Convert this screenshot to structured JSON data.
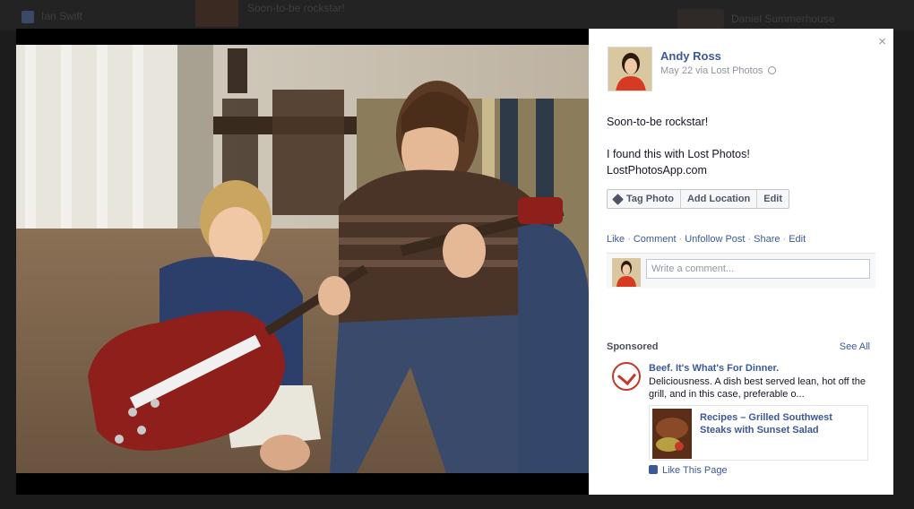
{
  "background": {
    "nav_label": "Ian Swift",
    "feed_text": "Soon-to-be rockstar!",
    "right_name": "Daniel Summerhouse"
  },
  "panel": {
    "close_glyph": "×",
    "author": "Andy Ross",
    "meta": "May 22 via Lost Photos",
    "post_line1": "Soon-to-be rockstar!",
    "post_line2": "I found this with Lost Photos!",
    "post_line3": "LostPhotosApp.com",
    "buttons": {
      "tag_photo": "Tag Photo",
      "add_location": "Add Location",
      "edit": "Edit"
    },
    "actions": {
      "like": "Like",
      "comment": "Comment",
      "unfollow": "Unfollow Post",
      "share": "Share",
      "edit": "Edit",
      "separator": "·"
    },
    "comment_placeholder": "Write a comment..."
  },
  "sponsored": {
    "heading": "Sponsored",
    "see_all": "See All",
    "ad_title": "Beef. It's What's For Dinner.",
    "ad_body": "Deliciousness. A dish best served lean, hot off the grill, and in this case, preferable o...",
    "card_link": "Recipes – Grilled Southwest Steaks with Sunset Salad",
    "like_page": "Like This Page"
  },
  "colors": {
    "link": "#3b5998",
    "muted": "#90949c",
    "ad_accent": "#c0392b"
  },
  "icons": [
    "close-icon",
    "globe-icon",
    "tag-icon",
    "thumbs-up-icon",
    "beef-logo-icon"
  ]
}
